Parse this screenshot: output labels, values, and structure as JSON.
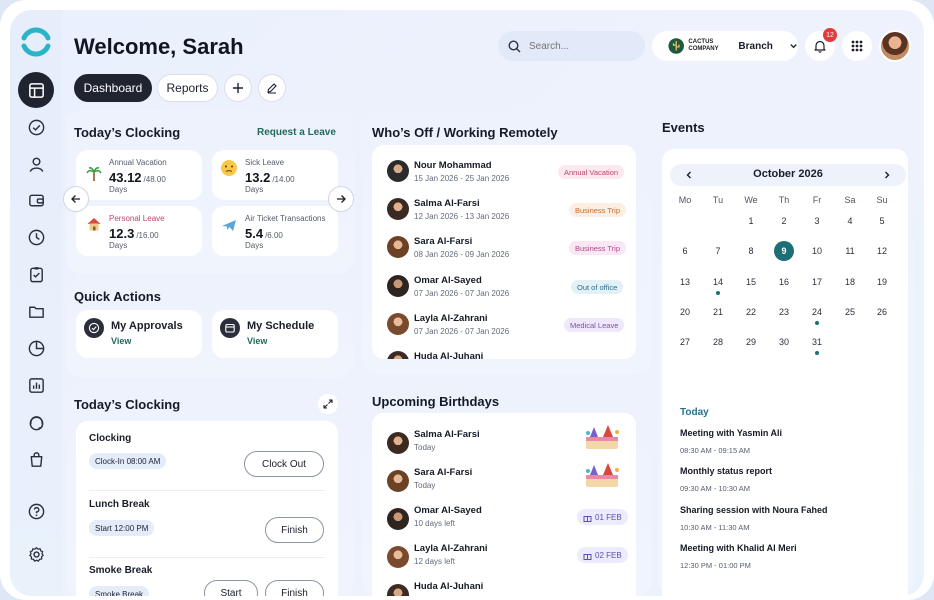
{
  "header": {
    "welcome": "Welcome, Sarah",
    "tabs": [
      "Dashboard",
      "Reports"
    ],
    "search_placeholder": "Search...",
    "company_name": "CACTUS COMPANY",
    "branch_label": "Branch",
    "notification_count": "12"
  },
  "clocking_summary": {
    "title": "Today’s Clocking",
    "request_link": "Request a Leave",
    "cards": [
      {
        "title": "Annual Vacation",
        "value": "43.12",
        "total": "/48.00",
        "unit": "Days",
        "icon": "palm-tree-icon"
      },
      {
        "title": "Sick Leave",
        "value": "13.2",
        "total": "/14.00",
        "unit": "Days",
        "icon": "sick-face-icon"
      },
      {
        "title": "Personal Leave",
        "value": "12.3",
        "total": "/16.00",
        "unit": "Days",
        "icon": "house-icon"
      },
      {
        "title": "Air Ticket Transactions",
        "value": "5.4",
        "total": "/6.00",
        "unit": "Days",
        "icon": "airplane-icon"
      }
    ]
  },
  "quick_actions": {
    "title": "Quick Actions",
    "items": [
      {
        "title": "My Approvals",
        "link": "View"
      },
      {
        "title": "My Schedule",
        "link": "View"
      }
    ]
  },
  "clocking": {
    "title": "Today’s Clocking",
    "rows": [
      {
        "title": "Clocking",
        "tag": "Clock-In 08:00 AM",
        "actions": [
          "Clock Out"
        ]
      },
      {
        "title": "Lunch Break",
        "tag": "Start 12:00 PM",
        "actions": [
          "Finish"
        ]
      },
      {
        "title": "Smoke Break",
        "tag": "Smoke Break",
        "actions": [
          "Start",
          "Finish"
        ]
      }
    ]
  },
  "whos_off": {
    "title": "Who’s Off / Working Remotely",
    "people": [
      {
        "name": "Nour Mohammad",
        "dates": "15 Jan 2026 - 25 Jan 2026",
        "tag": "Annual Vacation",
        "tag_color": "#c0456a",
        "tag_bg": "#fbe9ef"
      },
      {
        "name": "Salma Al-Farsi",
        "dates": "12 Jan 2026 - 13 Jan 2026",
        "tag": "Business Trip",
        "tag_color": "#c56a2c",
        "tag_bg": "#fdeee3"
      },
      {
        "name": "Sara Al-Farsi",
        "dates": "08 Jan 2026 - 09 Jan 2026",
        "tag": "Business Trip",
        "tag_color": "#b04a8c",
        "tag_bg": "#f9e7f3"
      },
      {
        "name": "Omar Al-Sayed",
        "dates": "07 Jan 2026 - 07 Jan 2026",
        "tag": "Out of office",
        "tag_color": "#2a6f8c",
        "tag_bg": "#e3f1f7"
      },
      {
        "name": "Layla Al-Zahrani",
        "dates": "07 Jan 2026 - 07 Jan 2026",
        "tag": "Medical Leave",
        "tag_color": "#7a4fb2",
        "tag_bg": "#efe8fa"
      },
      {
        "name": "Huda Al-Juhani",
        "dates": "",
        "tag": "",
        "tag_color": "#c0456a",
        "tag_bg": "#fbe9ef"
      }
    ]
  },
  "birthdays": {
    "title": "Upcoming Birthdays",
    "people": [
      {
        "name": "Salma Al-Farsi",
        "when": "Today",
        "date": ""
      },
      {
        "name": "Sara Al-Farsi",
        "when": "Today",
        "date": ""
      },
      {
        "name": "Omar Al-Sayed",
        "when": "10 days left",
        "date": "01 FEB"
      },
      {
        "name": "Layla Al-Zahrani",
        "when": "12 days left",
        "date": "02 FEB"
      },
      {
        "name": "Huda Al-Juhani",
        "when": "",
        "date": ""
      }
    ]
  },
  "events": {
    "title": "Events",
    "month": "October 2026",
    "weekdays": [
      "Mo",
      "Tu",
      "We",
      "Th",
      "Fr",
      "Sa",
      "Su"
    ],
    "first_weekday_index": 2,
    "days_in_month": 31,
    "selected_day": 9,
    "event_days": [
      14,
      24,
      31
    ],
    "today_label": "Today",
    "items": [
      {
        "title": "Meeting with Yasmin Ali",
        "time": "08:30 AM - 09:15 AM"
      },
      {
        "title": "Monthly status report",
        "time": "09:30 AM - 10:30 AM"
      },
      {
        "title": "Sharing session with Noura Fahed",
        "time": "10:30 AM - 11:30 AM"
      },
      {
        "title": "Meeting with Khalid Al Meri",
        "time": "12:30 PM - 01:00 PM"
      }
    ]
  },
  "sidebar": {
    "items": [
      "layout-icon",
      "check-circle-icon",
      "user-icon",
      "wallet-icon",
      "clock-icon",
      "clipboard-check-icon",
      "folder-icon",
      "pie-chart-icon",
      "bar-chart-icon",
      "headset-icon",
      "bag-icon",
      "help-icon",
      "settings-icon"
    ]
  },
  "colors": {
    "accent": "#1d6f75",
    "dark": "#1f2430",
    "link": "#1f6a5b"
  }
}
